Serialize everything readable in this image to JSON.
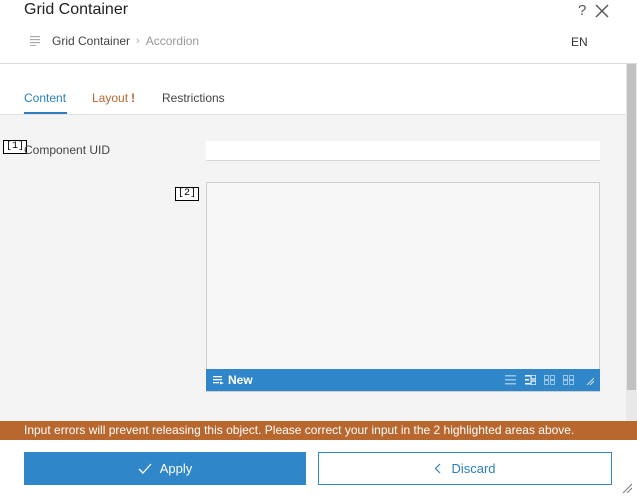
{
  "header": {
    "title": "Grid Container",
    "help_label": "?",
    "breadcrumb": [
      "Grid Container",
      "Accordion"
    ],
    "breadcrumb_sep": "›",
    "language": "EN"
  },
  "tabs": [
    {
      "label": "Content",
      "active": true
    },
    {
      "label": "Layout",
      "error_mark": "!"
    },
    {
      "label": "Restrictions"
    }
  ],
  "form": {
    "marker_1": "[1]",
    "marker_2": "[2]",
    "uid_label": "Component UID",
    "uid_value": "",
    "list_new_label": "New"
  },
  "icons": {
    "help": "help-icon",
    "close": "close-icon",
    "document": "document-icon",
    "new": "list-add-icon",
    "toolbar": [
      "list-view-icon",
      "tree-view-icon",
      "grid-view-icon",
      "tile-view-icon",
      "resize-icon"
    ]
  },
  "error_message": "Input errors will prevent releasing this object. Please correct your input in the 2 highlighted areas above.",
  "footer": {
    "apply_label": "Apply",
    "discard_label": "Discard"
  },
  "colors": {
    "accent": "#2f86c8",
    "error": "#b8672e"
  }
}
